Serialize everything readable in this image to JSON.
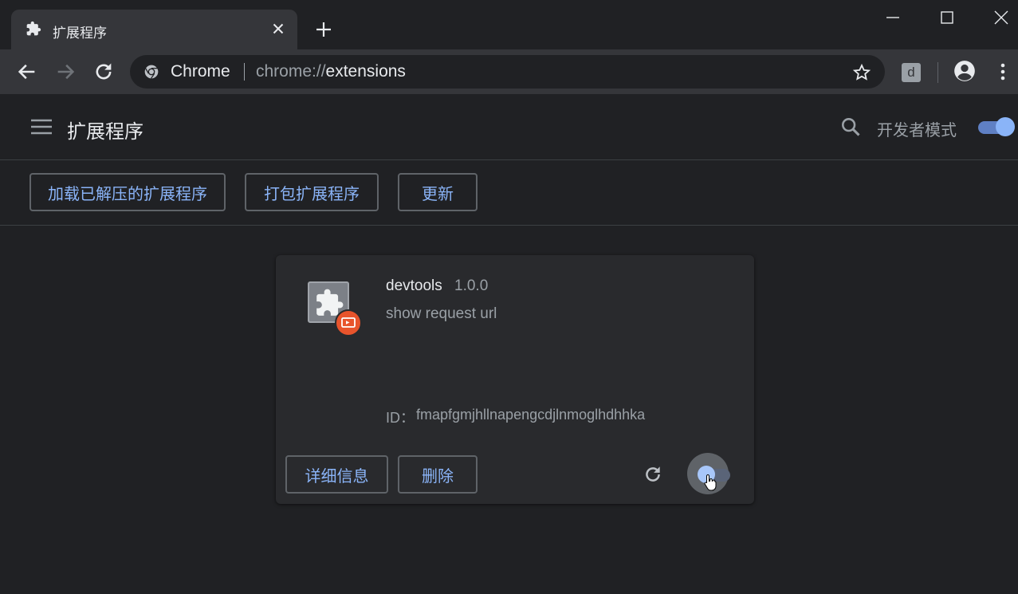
{
  "tab": {
    "title": "扩展程序",
    "icon": "puzzle-icon"
  },
  "omnibox": {
    "site_name": "Chrome",
    "url_scheme": "chrome://",
    "url_host": "extensions"
  },
  "toolbar": {
    "extension_letter": "d"
  },
  "header": {
    "title": "扩展程序",
    "dev_mode_label": "开发者模式",
    "dev_mode_on": true
  },
  "actions": {
    "load_unpacked": "加载已解压的扩展程序",
    "pack": "打包扩展程序",
    "update": "更新"
  },
  "extension": {
    "name": "devtools",
    "version": "1.0.0",
    "description": "show request url",
    "id_label": "ID：",
    "id": "fmapfgmjhllnapengcdjlnmoglhdhhka",
    "details_label": "详细信息",
    "remove_label": "删除",
    "enabled": true
  },
  "colors": {
    "accent": "#8ab4f8",
    "background": "#202124",
    "card": "#292a2d",
    "badge": "#e8542c"
  }
}
